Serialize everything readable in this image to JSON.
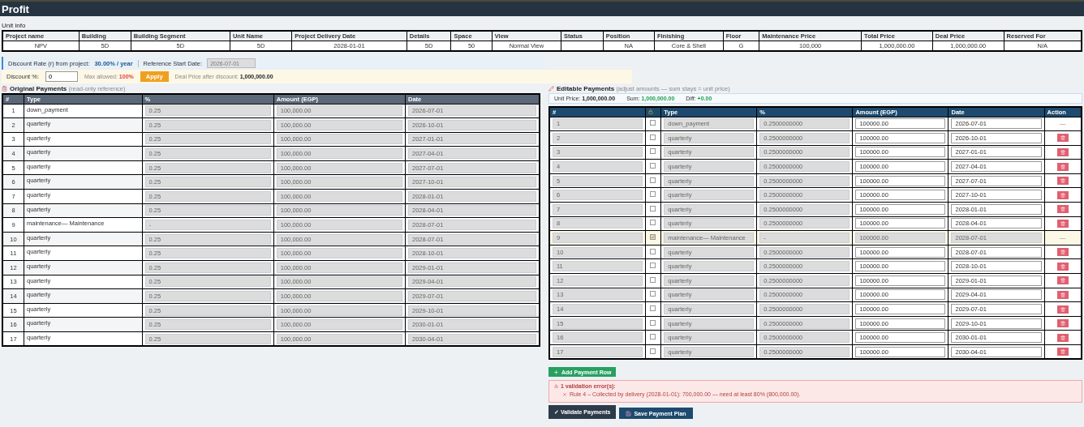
{
  "app": {
    "logo": "Profit"
  },
  "unit_info": {
    "title": "Unit info",
    "fields": [
      {
        "label": "Project name",
        "value": "NPV"
      },
      {
        "label": "Building",
        "value": "5D"
      },
      {
        "label": "Building Segment",
        "value": "5D"
      },
      {
        "label": "Unit Name",
        "value": "5D"
      },
      {
        "label": "Project Delivery Date",
        "value": "2028-01-01"
      },
      {
        "label": "Details",
        "value": "5D"
      },
      {
        "label": "Space",
        "value": "50"
      },
      {
        "label": "View",
        "value": "Normal View"
      },
      {
        "label": "Status"
      },
      {
        "label": "Position",
        "value": "NA"
      },
      {
        "label": "Finishing",
        "value": "Core & Shell"
      },
      {
        "label": "Floor",
        "value": "G"
      },
      {
        "label": "Maintenance Price",
        "value": "100,000"
      },
      {
        "label": "Total Price",
        "value": "1,000,000.00"
      },
      {
        "label": "Deal Price",
        "value": "1,000,000.00"
      },
      {
        "label": "Reserved For",
        "value": "N/A"
      }
    ]
  },
  "discount_rate": {
    "label": "Discount Rate (r) from project:",
    "value": "30.00% / year",
    "ref_label": "Reference Start Date:",
    "ref_value": "2026-07-01"
  },
  "discount": {
    "label": "Discount %:",
    "value": "0",
    "max_label": "Max allowed:",
    "max_value": "100%",
    "apply": "Apply",
    "deal_label": "Deal Price after discount:",
    "deal_value": "1,000,000.00"
  },
  "original_payments": {
    "title": "Original Payments",
    "note": "(read-only reference)",
    "columns": [
      "#",
      "Type",
      "%",
      "Amount (EGP)",
      "Date"
    ],
    "rows": [
      {
        "num": "1",
        "type": "down_payment",
        "percent": "0.25",
        "amount": "100,000.00",
        "date": "2026-07-01"
      },
      {
        "num": "2",
        "type": "quarterly",
        "percent": "0.25",
        "amount": "100,000.00",
        "date": "2026-10-01"
      },
      {
        "num": "3",
        "type": "quarterly",
        "percent": "0.25",
        "amount": "100,000.00",
        "date": "2027-01-01"
      },
      {
        "num": "4",
        "type": "quarterly",
        "percent": "0.25",
        "amount": "100,000.00",
        "date": "2027-04-01"
      },
      {
        "num": "5",
        "type": "quarterly",
        "percent": "0.25",
        "amount": "100,000.00",
        "date": "2027-07-01"
      },
      {
        "num": "6",
        "type": "quarterly",
        "percent": "0.25",
        "amount": "100,000.00",
        "date": "2027-10-01"
      },
      {
        "num": "7",
        "type": "quarterly",
        "percent": "0.25",
        "amount": "100,000.00",
        "date": "2028-01-01"
      },
      {
        "num": "8",
        "type": "quarterly",
        "percent": "0.25",
        "amount": "100,000.00",
        "date": "2028-04-01"
      },
      {
        "num": "9",
        "type": "maintenance— Maintenance",
        "percent": "-",
        "amount": "100,000.00",
        "date": "2028-07-01"
      },
      {
        "num": "10",
        "type": "quarterly",
        "percent": "0.25",
        "amount": "100,000.00",
        "date": "2028-07-01"
      },
      {
        "num": "11",
        "type": "quarterly",
        "percent": "0.25",
        "amount": "100,000.00",
        "date": "2028-10-01"
      },
      {
        "num": "12",
        "type": "quarterly",
        "percent": "0.25",
        "amount": "100,000.00",
        "date": "2029-01-01"
      },
      {
        "num": "13",
        "type": "quarterly",
        "percent": "0.25",
        "amount": "100,000.00",
        "date": "2029-04-01"
      },
      {
        "num": "14",
        "type": "quarterly",
        "percent": "0.25",
        "amount": "100,000.00",
        "date": "2029-07-01"
      },
      {
        "num": "15",
        "type": "quarterly",
        "percent": "0.25",
        "amount": "100,000.00",
        "date": "2029-10-01"
      },
      {
        "num": "16",
        "type": "quarterly",
        "percent": "0.25",
        "amount": "100,000.00",
        "date": "2030-01-01"
      },
      {
        "num": "17",
        "type": "quarterly",
        "percent": "0.25",
        "amount": "100,000.00",
        "date": "2030-04-01"
      }
    ]
  },
  "editable_payments": {
    "title": "Editable Payments",
    "note": "(adjust amounts — sum stays = unit price)",
    "summary": [
      {
        "label": "Unit Price:",
        "value": "1,000,000.00",
        "kind": "plain"
      },
      {
        "label": "Sum:",
        "value": "1,000,000.00",
        "kind": "good"
      },
      {
        "label": "Diff:",
        "value": "+0.00",
        "kind": "good"
      }
    ],
    "columns": [
      "#",
      "Type",
      "%",
      "Amount (EGP)",
      "Date",
      "Action"
    ],
    "rows": [
      {
        "num": "1",
        "locked": false,
        "type": "down_payment",
        "percent": "0.2500000000",
        "amount": "100000.00",
        "date": "2026-07-01",
        "deletable": false,
        "action_text": "—"
      },
      {
        "num": "2",
        "locked": false,
        "type": "quarterly",
        "percent": "0.2500000000",
        "amount": "100000.00",
        "date": "2026-10-01",
        "deletable": true
      },
      {
        "num": "3",
        "locked": false,
        "type": "quarterly",
        "percent": "0.2500000000",
        "amount": "100000.00",
        "date": "2027-01-01",
        "deletable": true
      },
      {
        "num": "4",
        "locked": false,
        "type": "quarterly",
        "percent": "0.2500000000",
        "amount": "100000.00",
        "date": "2027-04-01",
        "deletable": true
      },
      {
        "num": "5",
        "locked": false,
        "type": "quarterly",
        "percent": "0.2500000000",
        "amount": "100000.00",
        "date": "2027-07-01",
        "deletable": true
      },
      {
        "num": "6",
        "locked": false,
        "type": "quarterly",
        "percent": "0.2500000000",
        "amount": "100000.00",
        "date": "2027-10-01",
        "deletable": true
      },
      {
        "num": "7",
        "locked": false,
        "type": "quarterly",
        "percent": "0.2500000000",
        "amount": "100000.00",
        "date": "2028-01-01",
        "deletable": true
      },
      {
        "num": "8",
        "locked": false,
        "type": "quarterly",
        "percent": "0.2500000000",
        "amount": "100000.00",
        "date": "2028-04-01",
        "deletable": true
      },
      {
        "num": "9",
        "locked": true,
        "type": "maintenance— Maintenance",
        "percent": "-",
        "amount": "100000.00",
        "date": "2028-07-01",
        "deletable": false,
        "action_text": "—"
      },
      {
        "num": "10",
        "locked": false,
        "type": "quarterly",
        "percent": "0.2500000000",
        "amount": "100000.00",
        "date": "2028-07-01",
        "deletable": true
      },
      {
        "num": "11",
        "locked": false,
        "type": "quarterly",
        "percent": "0.2500000000",
        "amount": "100000.00",
        "date": "2028-10-01",
        "deletable": true
      },
      {
        "num": "12",
        "locked": false,
        "type": "quarterly",
        "percent": "0.2500000000",
        "amount": "100000.00",
        "date": "2029-01-01",
        "deletable": true
      },
      {
        "num": "13",
        "locked": false,
        "type": "quarterly",
        "percent": "0.2500000000",
        "amount": "100000.00",
        "date": "2029-04-01",
        "deletable": true
      },
      {
        "num": "14",
        "locked": false,
        "type": "quarterly",
        "percent": "0.2500000000",
        "amount": "100000.00",
        "date": "2029-07-01",
        "deletable": true
      },
      {
        "num": "15",
        "locked": false,
        "type": "quarterly",
        "percent": "0.2500000000",
        "amount": "100000.00",
        "date": "2029-10-01",
        "deletable": true
      },
      {
        "num": "16",
        "locked": false,
        "type": "quarterly",
        "percent": "0.2500000000",
        "amount": "100000.00",
        "date": "2030-01-01",
        "deletable": true
      },
      {
        "num": "17",
        "locked": false,
        "type": "quarterly",
        "percent": "0.2500000000",
        "amount": "100000.00",
        "date": "2030-04-01",
        "deletable": true
      }
    ],
    "add_button": "Add Payment Row",
    "errors": {
      "title": "1 validation error(s):",
      "items": [
        "Rule 4 – Collected by delivery (2028-01-01): 700,000.00 — need at least 80% (800,000.00)."
      ]
    },
    "validate_button": "✓ Validate Payments",
    "save_button": "Save Payment Plan"
  }
}
